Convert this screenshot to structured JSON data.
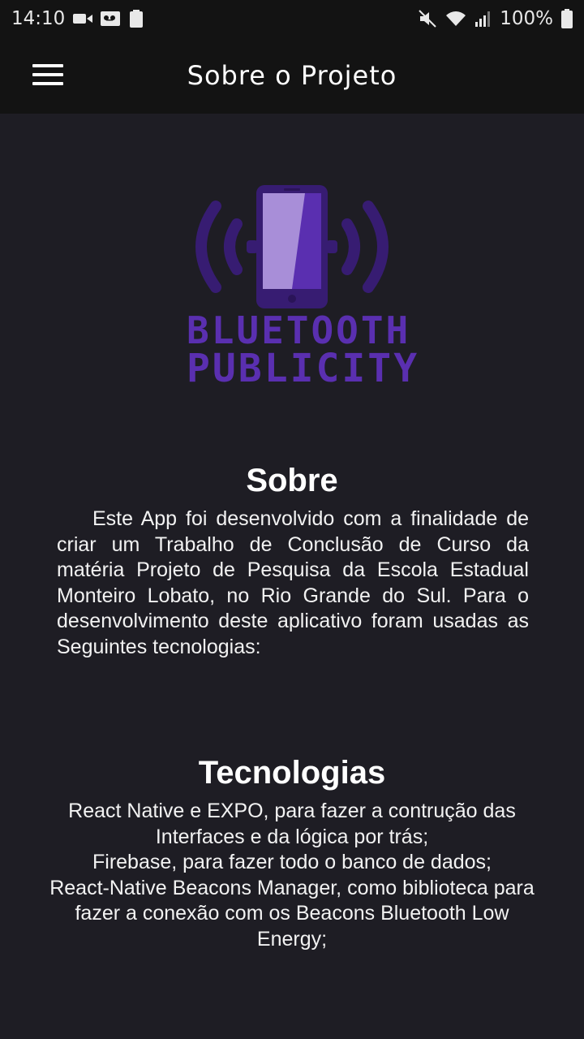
{
  "status_bar": {
    "time": "14:10",
    "battery": "100%"
  },
  "app_bar": {
    "title": "Sobre o Projeto"
  },
  "logo": {
    "line1": "BLUETOOTH",
    "line2": "PUBLICITY",
    "color": "#5a2fb0"
  },
  "about": {
    "title": "Sobre",
    "text": "Este App foi desenvolvido com a finalidade de criar um Trabalho de Conclusão de Curso da matéria Projeto de Pesquisa da Escola Estadual Monteiro Lobato, no Rio Grande do Sul. Para o desenvolvimento deste aplicativo foram usadas as Seguintes tecnologias:"
  },
  "technologies": {
    "title": "Tecnologias",
    "items": [
      "React Native e EXPO, para fazer a contrução das Interfaces e da lógica por trás;",
      "Firebase, para fazer todo o banco de dados;",
      "React-Native Beacons Manager, como biblioteca para fazer a conexão com os Beacons Bluetooth Low Energy;"
    ]
  },
  "colors": {
    "background": "#1e1d24",
    "app_bar": "#131313",
    "accent": "#5a2fb0"
  }
}
